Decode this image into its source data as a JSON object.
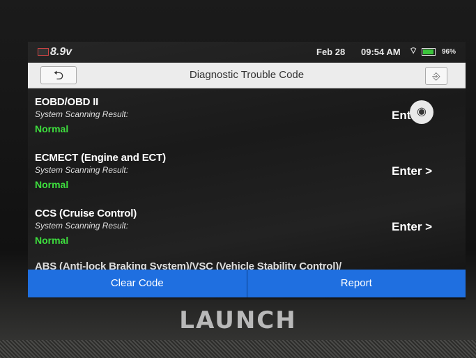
{
  "status_bar": {
    "voltage": "8.9v",
    "date": "Feb 28",
    "time": "09:54 AM",
    "battery_pct": "96%",
    "battery_level": 0.96
  },
  "title_bar": {
    "back_icon": "back-arrow-icon",
    "title": "Diagnostic Trouble Code",
    "exit_icon": "exit-icon"
  },
  "systems": [
    {
      "name": "EOBD/OBD II",
      "result_label": "System Scanning Result:",
      "status": "Normal",
      "enter_label": "Enter >"
    },
    {
      "name": "ECMECT (Engine and ECT)",
      "result_label": "System Scanning Result:",
      "status": "Normal",
      "enter_label": "Enter >"
    },
    {
      "name": "CCS (Cruise Control)",
      "result_label": "System Scanning Result:",
      "status": "Normal",
      "enter_label": "Enter >"
    },
    {
      "name": "ABS (Anti-lock Braking System)/VSC (Vehicle Stability Control)/"
    }
  ],
  "actions": {
    "clear_code": "Clear Code",
    "report": "Report"
  },
  "brand": "LAUNCH",
  "colors": {
    "accent_blue": "#1f6fe0",
    "status_normal": "#3edf3e"
  }
}
